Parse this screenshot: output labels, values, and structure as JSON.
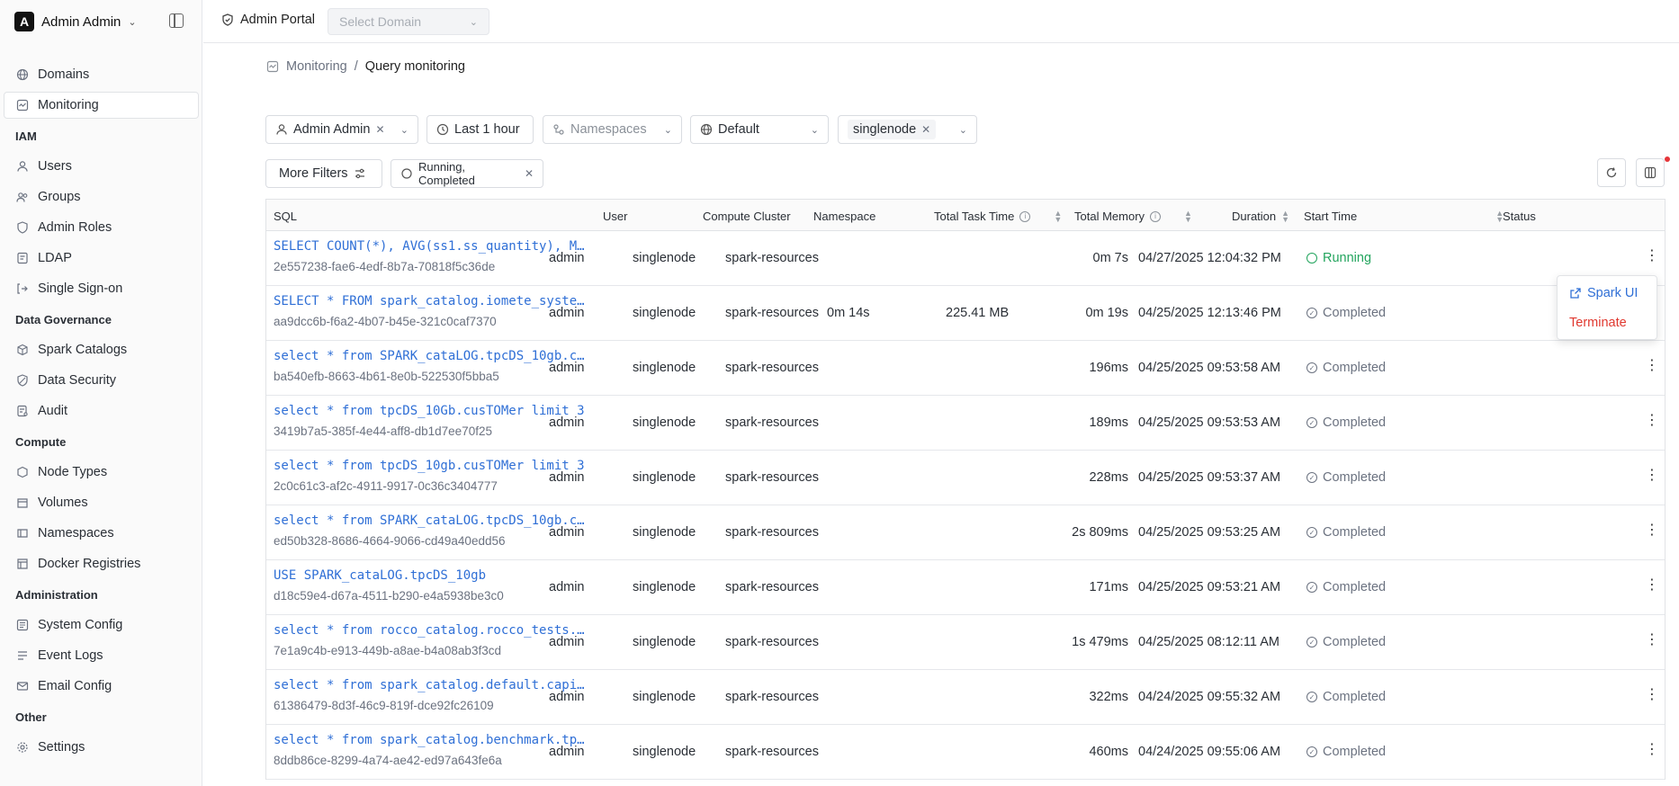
{
  "org": {
    "logo_letter": "A",
    "name": "Admin Admin"
  },
  "sidebar": {
    "groups": [
      {
        "section": "",
        "items": [
          {
            "label": "Domains",
            "icon": "globe-icon"
          },
          {
            "label": "Monitoring",
            "icon": "monitor-icon",
            "active": true
          }
        ]
      },
      {
        "section": "IAM",
        "items": [
          {
            "label": "Users",
            "icon": "user-icon"
          },
          {
            "label": "Groups",
            "icon": "group-icon"
          },
          {
            "label": "Admin Roles",
            "icon": "shield-icon"
          },
          {
            "label": "LDAP",
            "icon": "ldap-icon"
          },
          {
            "label": "Single Sign-on",
            "icon": "sign-in-icon"
          }
        ]
      },
      {
        "section": "Data Governance",
        "items": [
          {
            "label": "Spark Catalogs",
            "icon": "cube-icon"
          },
          {
            "label": "Data Security",
            "icon": "shield-check-icon"
          },
          {
            "label": "Audit",
            "icon": "audit-icon"
          }
        ]
      },
      {
        "section": "Compute",
        "items": [
          {
            "label": "Node Types",
            "icon": "node-icon"
          },
          {
            "label": "Volumes",
            "icon": "volume-icon"
          },
          {
            "label": "Namespaces",
            "icon": "namespace-icon"
          },
          {
            "label": "Docker Registries",
            "icon": "docker-icon"
          }
        ]
      },
      {
        "section": "Administration",
        "items": [
          {
            "label": "System Config",
            "icon": "config-icon"
          },
          {
            "label": "Event Logs",
            "icon": "logs-icon"
          },
          {
            "label": "Email Config",
            "icon": "mail-icon"
          }
        ]
      },
      {
        "section": "Other",
        "items": [
          {
            "label": "Settings",
            "icon": "gear-icon"
          }
        ]
      }
    ]
  },
  "topbar": {
    "portal_label": "Admin Portal",
    "domain_placeholder": "Select Domain"
  },
  "breadcrumb": {
    "parent": "Monitoring",
    "separator": "/",
    "current": "Query monitoring"
  },
  "filters": {
    "user": "Admin Admin",
    "time": "Last 1 hour",
    "namespaces": "Namespaces",
    "catalog": "Default",
    "cluster": "singlenode",
    "more_filters": "More Filters",
    "status_filter": "Running, Completed"
  },
  "table": {
    "headers": {
      "sql": "SQL",
      "user": "User",
      "cluster": "Compute Cluster",
      "namespace": "Namespace",
      "task_time": "Total Task Time",
      "memory": "Total Memory",
      "duration": "Duration",
      "start_time": "Start Time",
      "status": "Status"
    },
    "rows": [
      {
        "sql": "SELECT COUNT(*), AVG(ss1.ss_quantity), M…",
        "id": "2e557238-fae6-4edf-8b7a-70818f5c36de",
        "user": "admin",
        "cluster": "singlenode",
        "namespace": "spark-resources",
        "task_time": "",
        "memory": "",
        "duration": "0m 7s",
        "start": "04/27/2025 12:04:32 PM",
        "status": "Running"
      },
      {
        "sql": "SELECT * FROM spark_catalog.iomete_syste…",
        "id": "aa9dcc6b-f6a2-4b07-b45e-321c0caf7370",
        "user": "admin",
        "cluster": "singlenode",
        "namespace": "spark-resources",
        "task_time": "0m 14s",
        "memory": "225.41 MB",
        "duration": "0m 19s",
        "start": "04/25/2025 12:13:46 PM",
        "status": "Completed"
      },
      {
        "sql": "select * from SPARK_cataLOG.tpcDS_10gb.c…",
        "id": "ba540efb-8663-4b61-8e0b-522530f5bba5",
        "user": "admin",
        "cluster": "singlenode",
        "namespace": "spark-resources",
        "task_time": "",
        "memory": "",
        "duration": "196ms",
        "start": "04/25/2025 09:53:58 AM",
        "status": "Completed"
      },
      {
        "sql": "select * from tpcDS_10Gb.cusTOMer limit 3",
        "id": "3419b7a5-385f-4e44-aff8-db1d7ee70f25",
        "user": "admin",
        "cluster": "singlenode",
        "namespace": "spark-resources",
        "task_time": "",
        "memory": "",
        "duration": "189ms",
        "start": "04/25/2025 09:53:53 AM",
        "status": "Completed"
      },
      {
        "sql": "select * from tpcDS_10gb.cusTOMer limit 3",
        "id": "2c0c61c3-af2c-4911-9917-0c36c3404777",
        "user": "admin",
        "cluster": "singlenode",
        "namespace": "spark-resources",
        "task_time": "",
        "memory": "",
        "duration": "228ms",
        "start": "04/25/2025 09:53:37 AM",
        "status": "Completed"
      },
      {
        "sql": "select * from SPARK_cataLOG.tpcDS_10gb.c…",
        "id": "ed50b328-8686-4664-9066-cd49a40edd56",
        "user": "admin",
        "cluster": "singlenode",
        "namespace": "spark-resources",
        "task_time": "",
        "memory": "",
        "duration": "2s 809ms",
        "start": "04/25/2025 09:53:25 AM",
        "status": "Completed"
      },
      {
        "sql": "USE SPARK_cataLOG.tpcDS_10gb",
        "id": "d18c59e4-d67a-4511-b290-e4a5938be3c0",
        "user": "admin",
        "cluster": "singlenode",
        "namespace": "spark-resources",
        "task_time": "",
        "memory": "",
        "duration": "171ms",
        "start": "04/25/2025 09:53:21 AM",
        "status": "Completed"
      },
      {
        "sql": "select * from rocco_catalog.rocco_tests.…",
        "id": "7e1a9c4b-e913-449b-a8ae-b4a08ab3f3cd",
        "user": "admin",
        "cluster": "singlenode",
        "namespace": "spark-resources",
        "task_time": "",
        "memory": "",
        "duration": "1s 479ms",
        "start": "04/25/2025 08:12:11 AM",
        "status": "Completed"
      },
      {
        "sql": "select * from spark_catalog.default.capi…",
        "id": "61386479-8d3f-46c9-819f-dce92fc26109",
        "user": "admin",
        "cluster": "singlenode",
        "namespace": "spark-resources",
        "task_time": "",
        "memory": "",
        "duration": "322ms",
        "start": "04/24/2025 09:55:32 AM",
        "status": "Completed"
      },
      {
        "sql": "select * from spark_catalog.benchmark.tp…",
        "id": "8ddb86ce-8299-4a74-ae42-ed97a643fe6a",
        "user": "admin",
        "cluster": "singlenode",
        "namespace": "spark-resources",
        "task_time": "",
        "memory": "",
        "duration": "460ms",
        "start": "04/24/2025 09:55:06 AM",
        "status": "Completed"
      }
    ]
  },
  "popup_menu": {
    "spark_ui": "Spark UI",
    "terminate": "Terminate"
  },
  "colors": {
    "link": "#2f6fd6",
    "running": "#22a45d",
    "terminate": "#e0382f",
    "notification_dot": "#e5363a"
  }
}
